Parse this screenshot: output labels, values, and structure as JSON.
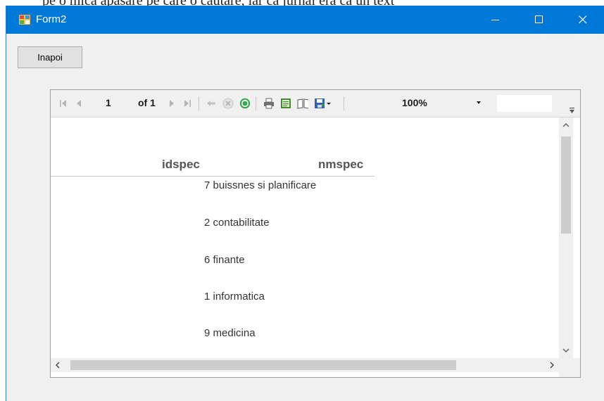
{
  "background": {
    "partial_text": "pe o mică apăsare pe care o căutare, iar ca jurnal era ca un text"
  },
  "window": {
    "title": "Form2",
    "title_bar_color": "#0078d7",
    "controls": {
      "minimize": "minimize-icon",
      "maximize": "maximize-icon",
      "close": "close-icon"
    }
  },
  "form": {
    "back_button_label": "Inapoi"
  },
  "viewer": {
    "toolbar": {
      "current_page": "1",
      "page_of": "of 1",
      "zoom": "100%",
      "icons": [
        "first-page-icon",
        "prev-page-icon",
        "next-page-icon",
        "last-page-icon",
        "back-icon",
        "stop-icon",
        "refresh-icon",
        "print-icon",
        "print-layout-icon",
        "page-setup-icon",
        "export-icon"
      ]
    },
    "report": {
      "columns": [
        "idspec",
        "nmspec"
      ],
      "rows": [
        {
          "idspec": "7",
          "nmspec": "buissnes si planificare"
        },
        {
          "idspec": "2",
          "nmspec": "contabilitate"
        },
        {
          "idspec": "6",
          "nmspec": "finante"
        },
        {
          "idspec": "1",
          "nmspec": "informatica"
        },
        {
          "idspec": "9",
          "nmspec": "medicina"
        }
      ]
    },
    "scrollbars": {
      "vertical_position": 0,
      "horizontal_position": 0
    }
  }
}
